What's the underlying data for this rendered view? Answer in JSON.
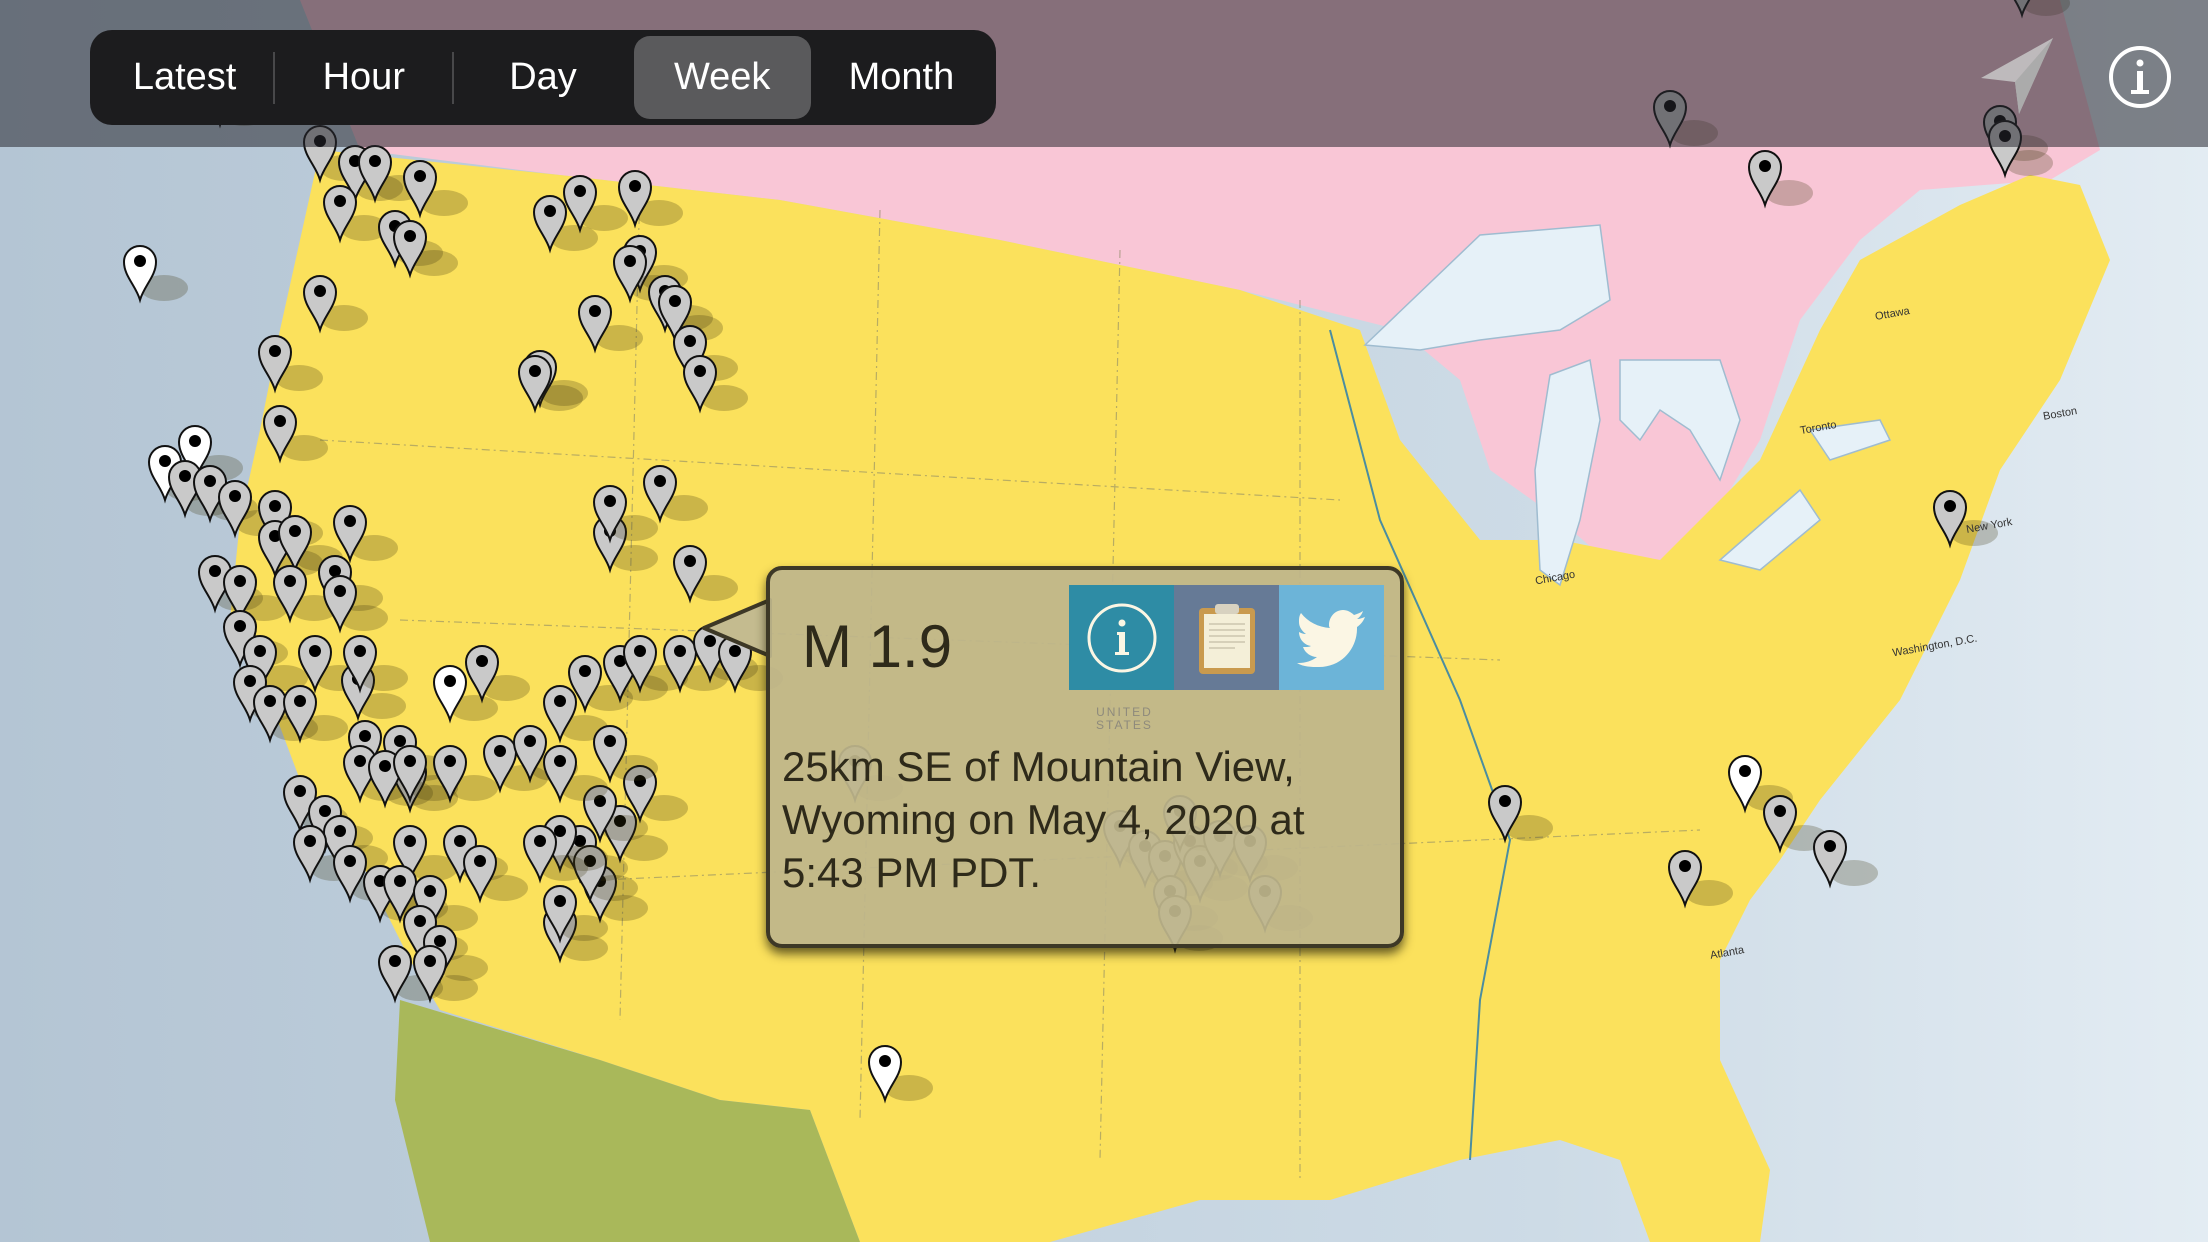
{
  "toolbar": {
    "segments": [
      {
        "label": "Latest",
        "selected": false
      },
      {
        "label": "Hour",
        "selected": false
      },
      {
        "label": "Day",
        "selected": false
      },
      {
        "label": "Week",
        "selected": true
      },
      {
        "label": "Month",
        "selected": false
      }
    ],
    "locate_icon": "location-arrow-icon",
    "info_icon": "info-circle-icon"
  },
  "map": {
    "colors": {
      "ocean": "#b9cad9",
      "usa": "#fbe15c",
      "canada": "#f9c6d6",
      "mexico": "#a9b85a",
      "lakes": "#e6f1f8",
      "pin_fill": "#c9c9c9",
      "pin_new_fill": "#ffffff"
    },
    "labels": {
      "ottawa": "Ottawa",
      "boston": "Boston",
      "toronto": "Toronto",
      "new_york": "New York",
      "chicago": "Chicago",
      "washington": "Washington, D.C.",
      "atlanta": "Atlanta",
      "country": [
        "UNITED",
        "STATES"
      ]
    },
    "pin_count_visible": "many"
  },
  "popup": {
    "magnitude": "M 1.9",
    "description": "25km SE of Mountain View, Wyoming on May 4, 2020 at 5:43 PM PDT.",
    "actions": [
      {
        "name": "info",
        "icon": "info-circle-icon",
        "color": "#2e8ca5"
      },
      {
        "name": "clipboard",
        "icon": "clipboard-icon",
        "color": "#667a96"
      },
      {
        "name": "twitter",
        "icon": "twitter-bird-icon",
        "color": "#6cb4d8"
      }
    ]
  }
}
